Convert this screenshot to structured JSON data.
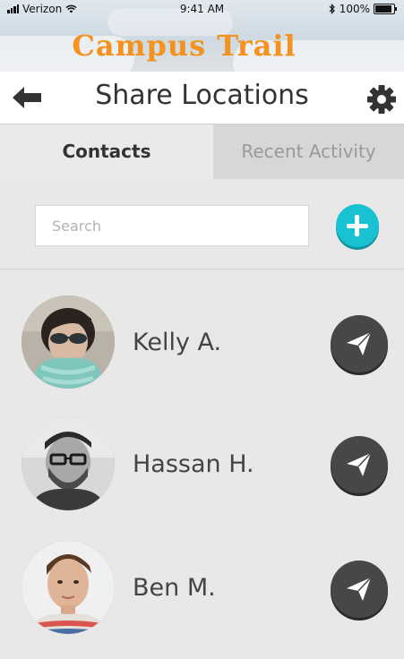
{
  "status_bar": {
    "carrier": "Verizon",
    "time": "9:41 AM",
    "battery": "100%"
  },
  "brand": {
    "title": "Campus Trail",
    "color": "#f3921e"
  },
  "header": {
    "title": "Share Locations"
  },
  "tabs": [
    {
      "label": "Contacts",
      "active": true
    },
    {
      "label": "Recent Activity",
      "active": false
    }
  ],
  "search": {
    "value": "",
    "placeholder": "Search"
  },
  "accent_color": "#19c2d2",
  "contacts": [
    {
      "name": "Kelly A."
    },
    {
      "name": "Hassan H."
    },
    {
      "name": "Ben M."
    }
  ],
  "icons": {
    "back": "arrow-left-icon",
    "settings": "gear-icon",
    "add": "plus-icon",
    "send": "paper-plane-icon"
  }
}
